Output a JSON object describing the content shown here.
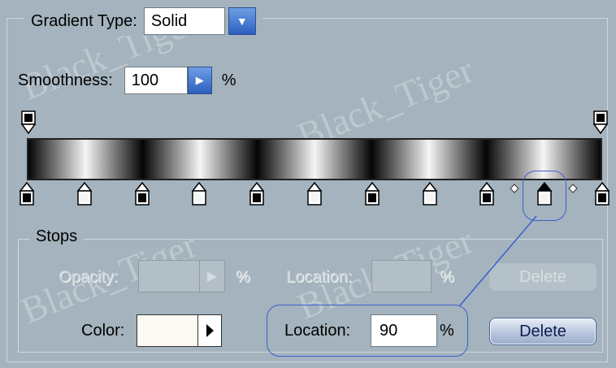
{
  "gradient_type": {
    "label": "Gradient Type:",
    "value": "Solid"
  },
  "smoothness": {
    "label": "Smoothness:",
    "value": "100",
    "unit": "%"
  },
  "gradient": {
    "colors": {
      "black": "#050505",
      "white": "#f5f5f5"
    },
    "opacity_stops_top": [
      0,
      100
    ],
    "color_stops_bottom": [
      {
        "loc": 0,
        "color": "black"
      },
      {
        "loc": 10,
        "color": "white"
      },
      {
        "loc": 20,
        "color": "black"
      },
      {
        "loc": 30,
        "color": "white"
      },
      {
        "loc": 40,
        "color": "black"
      },
      {
        "loc": 50,
        "color": "white"
      },
      {
        "loc": 60,
        "color": "black"
      },
      {
        "loc": 70,
        "color": "white"
      },
      {
        "loc": 80,
        "color": "black"
      },
      {
        "loc": 90,
        "color": "white",
        "selected": true
      },
      {
        "loc": 100,
        "color": "black"
      }
    ]
  },
  "stops_group": {
    "title": "Stops",
    "opacity": {
      "label": "Opacity:",
      "value": "",
      "unit": "%"
    },
    "opacity_location": {
      "label": "Location:",
      "value": "",
      "unit": "%"
    },
    "opacity_delete": "Delete",
    "color": {
      "label": "Color:",
      "swatch": "#fdfaf4"
    },
    "color_location": {
      "label": "Location:",
      "value": "90",
      "unit": "%"
    },
    "color_delete": "Delete"
  },
  "watermark": "Black_Tiger",
  "accent": "#3b5fd0"
}
